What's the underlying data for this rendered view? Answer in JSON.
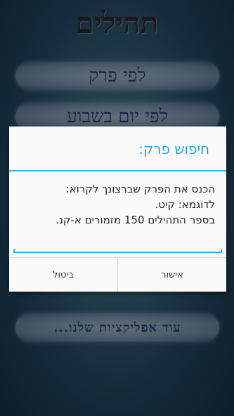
{
  "app": {
    "title": "תהילים"
  },
  "menu": {
    "by_chapter": "לפי פרק",
    "by_weekday": "לפי יום בשבוע",
    "more_apps": "עוד אפליקציות שלנו..."
  },
  "dialog": {
    "title": "חיפוש פרק:",
    "message_lines": [
      "הכנס את הפרק שברצונך לקרוא:",
      "לדוגמא: קיט.",
      "בספר התהילים 150 מזמורים א-קנ."
    ],
    "input_value": "",
    "cancel_label": "ביטול",
    "ok_label": "אישור"
  },
  "colors": {
    "accent": "#33b5e5",
    "pill_text": "#2f3a78",
    "title_text": "#2b2b2b"
  }
}
